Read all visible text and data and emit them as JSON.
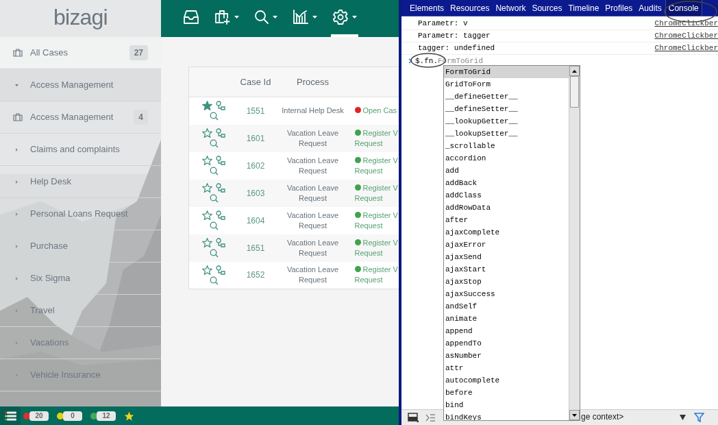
{
  "app": {
    "logo": "bizagi",
    "nav": [
      {
        "kind": "inbox",
        "dropdown": false,
        "selected": false
      },
      {
        "kind": "new-case",
        "dropdown": true,
        "selected": false
      },
      {
        "kind": "search",
        "dropdown": true,
        "selected": false
      },
      {
        "kind": "chart",
        "dropdown": true,
        "selected": false
      },
      {
        "kind": "gear",
        "dropdown": true,
        "selected": true
      }
    ],
    "sidebar": [
      {
        "kind": "item",
        "label": "All Cases",
        "count": "27",
        "selected": true
      },
      {
        "kind": "group",
        "label": "Access Management",
        "expanded": true
      },
      {
        "kind": "item",
        "label": "Access Management",
        "count": "4",
        "selected": false
      },
      {
        "kind": "group",
        "label": "Claims and complaints",
        "expanded": false
      },
      {
        "kind": "group",
        "label": "Help Desk",
        "expanded": false
      },
      {
        "kind": "group",
        "label": "Personal Loans Request",
        "expanded": false
      },
      {
        "kind": "group",
        "label": "Purchase",
        "expanded": false
      },
      {
        "kind": "group",
        "label": "Six Sigma",
        "expanded": false
      },
      {
        "kind": "group",
        "label": "Travel",
        "expanded": false
      },
      {
        "kind": "group",
        "label": "Vacations",
        "expanded": false
      },
      {
        "kind": "group",
        "label": "Vehicle Insurance",
        "expanded": false
      }
    ],
    "table": {
      "columns": [
        "Case Id",
        "Process"
      ],
      "rows": [
        {
          "starred": true,
          "case_id": "1551",
          "process": "Internal Help Desk",
          "activity": [
            "Open Cas"
          ],
          "color": "#e02424"
        },
        {
          "starred": false,
          "case_id": "1601",
          "process": "Vacation Leave Request",
          "activity": [
            "Register V",
            "Request"
          ],
          "color": "#3fa34d"
        },
        {
          "starred": false,
          "case_id": "1602",
          "process": "Vacation Leave Request",
          "activity": [
            "Register V",
            "Request"
          ],
          "color": "#3fa34d"
        },
        {
          "starred": false,
          "case_id": "1603",
          "process": "Vacation Leave Request",
          "activity": [
            "Register V",
            "Request"
          ],
          "color": "#3fa34d"
        },
        {
          "starred": false,
          "case_id": "1604",
          "process": "Vacation Leave Request",
          "activity": [
            "Register V",
            "Request"
          ],
          "color": "#3fa34d"
        },
        {
          "starred": false,
          "case_id": "1651",
          "process": "Vacation Leave Request",
          "activity": [
            "Register V",
            "Request"
          ],
          "color": "#3fa34d"
        },
        {
          "starred": false,
          "case_id": "1652",
          "process": "Vacation Leave Request",
          "activity": [
            "Register V",
            "Request"
          ],
          "color": "#3fa34d"
        }
      ]
    },
    "status_bar": [
      {
        "color": "#e52d2d",
        "count": "20"
      },
      {
        "color": "#e6cf0b",
        "count": "0"
      },
      {
        "color": "#44a95a",
        "count": "12"
      }
    ]
  },
  "devtools": {
    "tabs": [
      {
        "label": "Elements",
        "selected": false
      },
      {
        "label": "Resources",
        "selected": false
      },
      {
        "label": "Network",
        "selected": false
      },
      {
        "label": "Sources",
        "selected": false
      },
      {
        "label": "Timeline",
        "selected": false
      },
      {
        "label": "Profiles",
        "selected": false
      },
      {
        "label": "Audits",
        "selected": false
      },
      {
        "label": "Console",
        "selected": true
      }
    ],
    "log": [
      {
        "text": "Parametr: v",
        "source": "ChromeClickber"
      },
      {
        "text": "Parametr: tagger",
        "source": "ChromeClickber"
      },
      {
        "text": "tagger: undefined",
        "source": "ChromeClickber"
      }
    ],
    "prompt": {
      "value": "$.fn.",
      "placeholder": "FormToGrid"
    },
    "autocomplete": [
      {
        "label": "FormToGrid",
        "selected": true
      },
      {
        "label": "GridToForm",
        "selected": false
      },
      {
        "label": "__defineGetter__",
        "selected": false
      },
      {
        "label": "__defineSetter__",
        "selected": false
      },
      {
        "label": "__lookupGetter__",
        "selected": false
      },
      {
        "label": "__lookupSetter__",
        "selected": false
      },
      {
        "label": "_scrollable",
        "selected": false
      },
      {
        "label": "accordion",
        "selected": false
      },
      {
        "label": "add",
        "selected": false
      },
      {
        "label": "addBack",
        "selected": false
      },
      {
        "label": "addClass",
        "selected": false
      },
      {
        "label": "addRowData",
        "selected": false
      },
      {
        "label": "after",
        "selected": false
      },
      {
        "label": "ajaxComplete",
        "selected": false
      },
      {
        "label": "ajaxError",
        "selected": false
      },
      {
        "label": "ajaxSend",
        "selected": false
      },
      {
        "label": "ajaxStart",
        "selected": false
      },
      {
        "label": "ajaxStop",
        "selected": false
      },
      {
        "label": "ajaxSuccess",
        "selected": false
      },
      {
        "label": "andSelf",
        "selected": false
      },
      {
        "label": "animate",
        "selected": false
      },
      {
        "label": "append",
        "selected": false
      },
      {
        "label": "appendTo",
        "selected": false
      },
      {
        "label": "asNumber",
        "selected": false
      },
      {
        "label": "attr",
        "selected": false
      },
      {
        "label": "autocomplete",
        "selected": false
      },
      {
        "label": "before",
        "selected": false
      },
      {
        "label": "bind",
        "selected": false
      },
      {
        "label": "bindKeys",
        "selected": false
      }
    ],
    "context": "ge context>"
  }
}
